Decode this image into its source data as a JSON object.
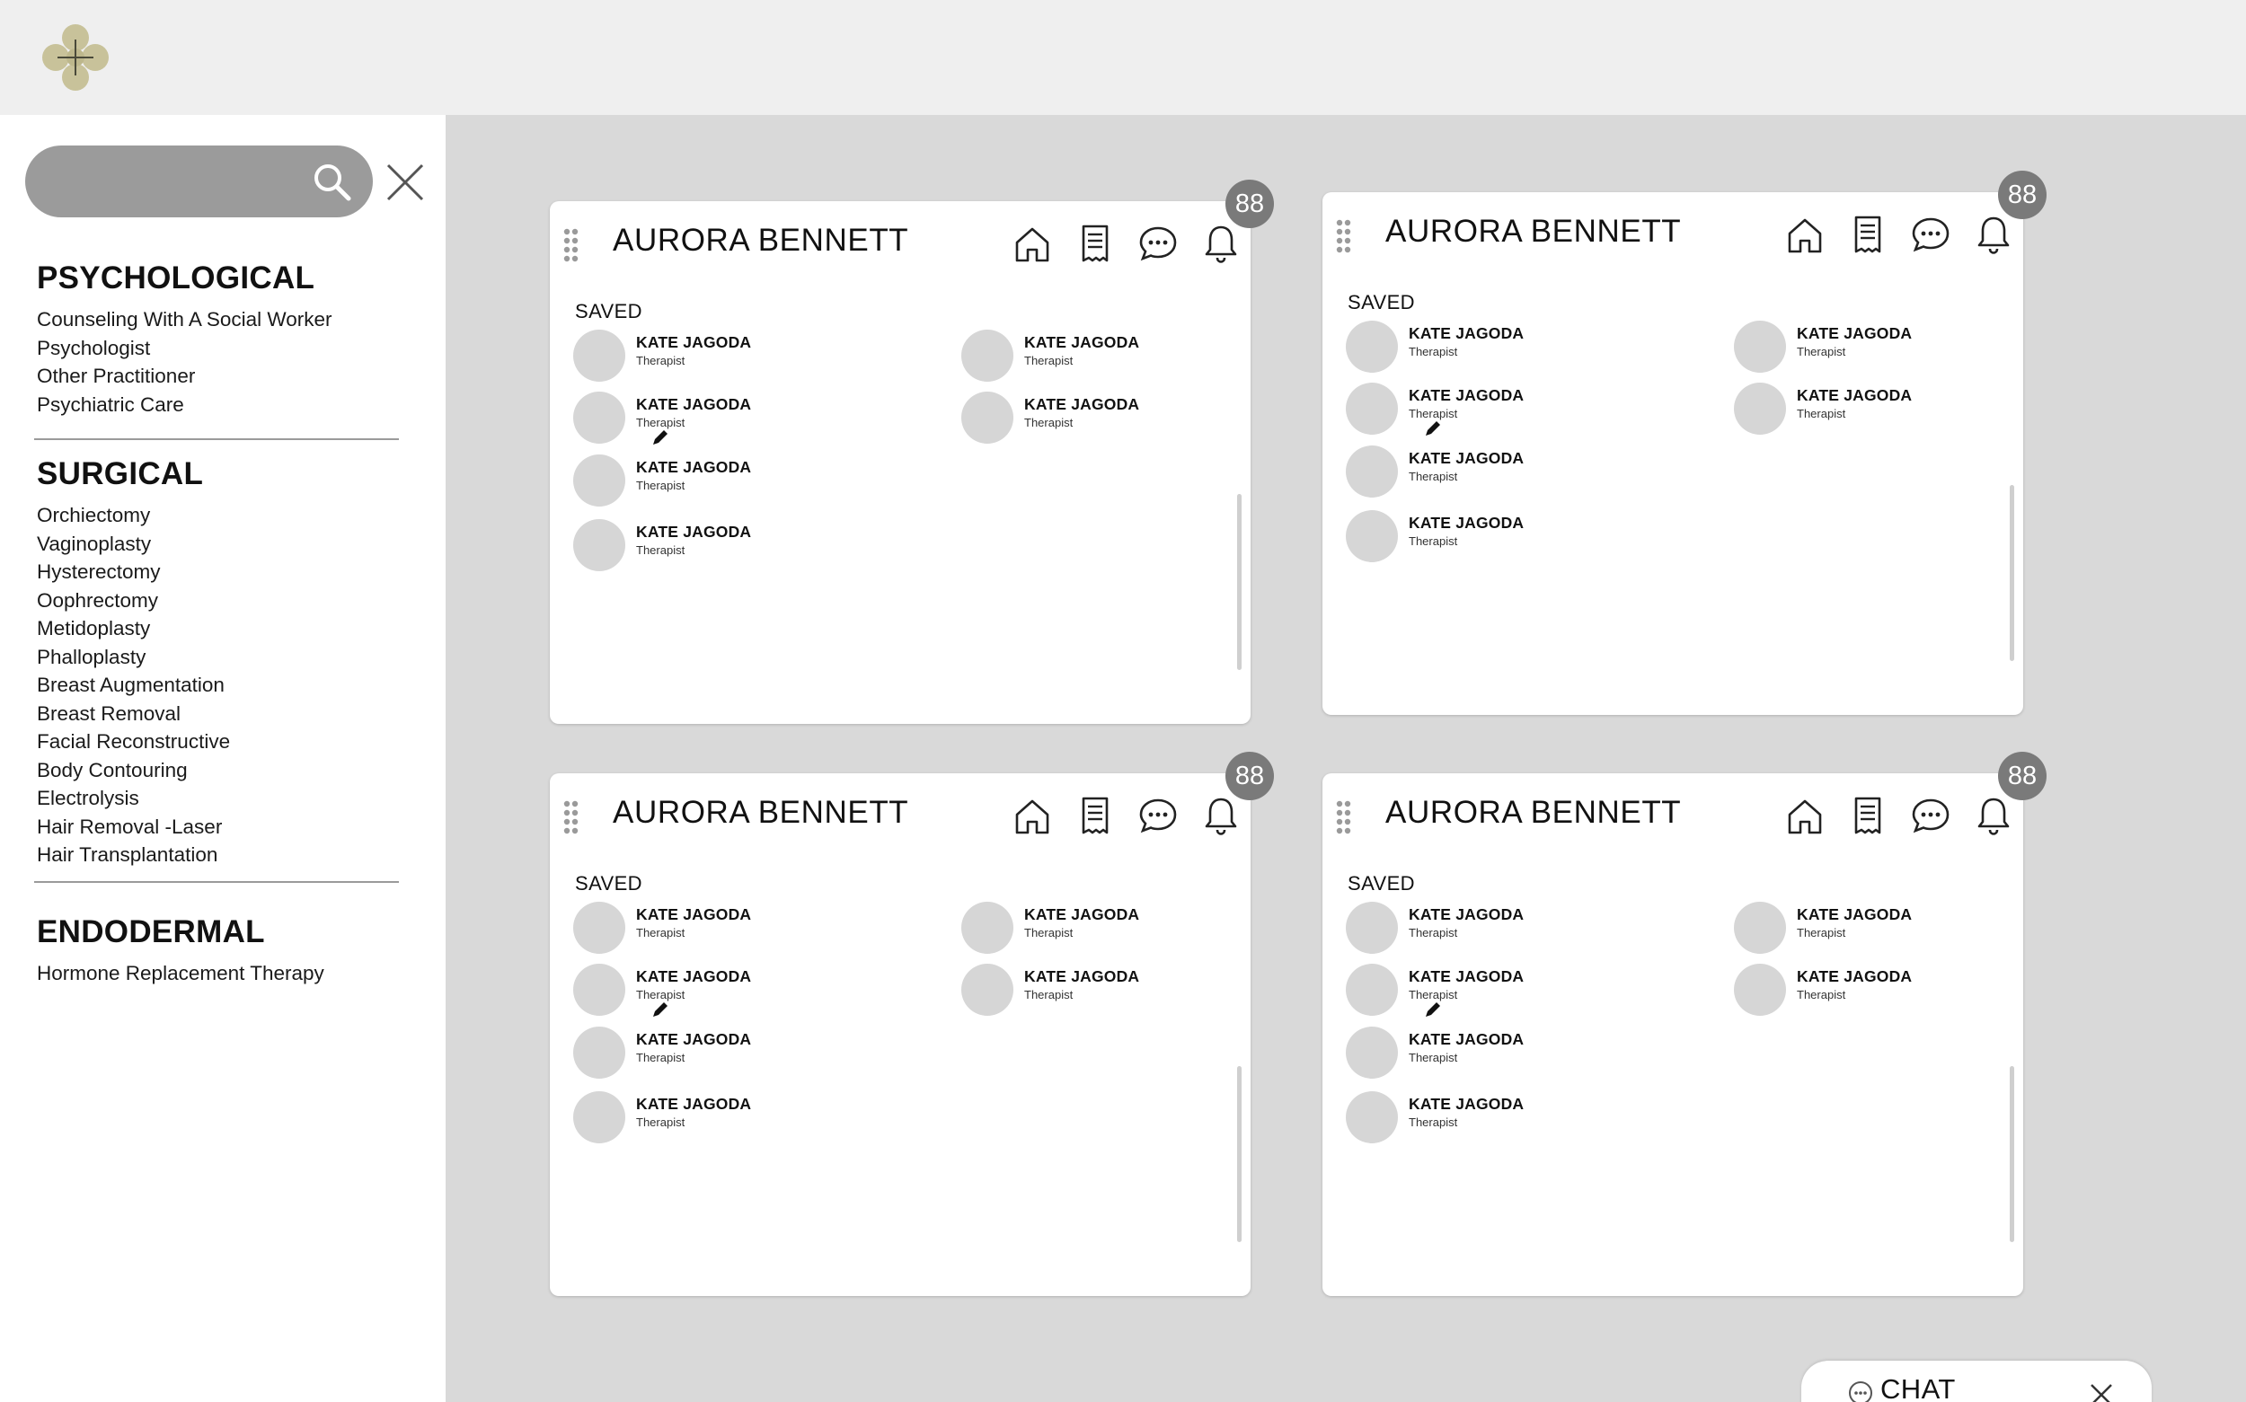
{
  "search": {
    "placeholder": ""
  },
  "categories": [
    {
      "title": "PSYCHOLOGICAL",
      "items": [
        "Counseling With A Social Worker",
        "Psychologist",
        "Other Practitioner",
        "Psychiatric Care"
      ]
    },
    {
      "title": "SURGICAL",
      "items": [
        "Orchiectomy",
        "Vaginoplasty",
        "Hysterectomy",
        "Oophrectomy",
        "Metidoplasty",
        "Phalloplasty",
        "Breast Augmentation",
        "Breast Removal",
        "Facial Reconstructive",
        "Body Contouring",
        "Electrolysis",
        "Hair Removal -Laser",
        "Hair Transplantation"
      ]
    },
    {
      "title": "ENDODERMAL",
      "items": [
        "Hormone Replacement Therapy"
      ]
    }
  ],
  "cards": [
    {
      "name": "AURORA BENNETT",
      "badge": "88",
      "section_label": "SAVED",
      "people": [
        {
          "name": "KATE JAGODA",
          "role": "Therapist"
        },
        {
          "name": "KATE JAGODA",
          "role": "Therapist"
        },
        {
          "name": "KATE JAGODA",
          "role": "Therapist"
        },
        {
          "name": "KATE JAGODA",
          "role": "Therapist"
        },
        {
          "name": "KATE JAGODA",
          "role": "Therapist"
        },
        {
          "name": "KATE JAGODA",
          "role": "Therapist"
        }
      ]
    },
    {
      "name": "AURORA BENNETT",
      "badge": "88",
      "section_label": "SAVED",
      "people": [
        {
          "name": "KATE JAGODA",
          "role": "Therapist"
        },
        {
          "name": "KATE JAGODA",
          "role": "Therapist"
        },
        {
          "name": "KATE JAGODA",
          "role": "Therapist"
        },
        {
          "name": "KATE JAGODA",
          "role": "Therapist"
        },
        {
          "name": "KATE JAGODA",
          "role": "Therapist"
        },
        {
          "name": "KATE JAGODA",
          "role": "Therapist"
        }
      ]
    },
    {
      "name": "AURORA BENNETT",
      "badge": "88",
      "section_label": "SAVED",
      "people": [
        {
          "name": "KATE JAGODA",
          "role": "Therapist"
        },
        {
          "name": "KATE JAGODA",
          "role": "Therapist"
        },
        {
          "name": "KATE JAGODA",
          "role": "Therapist"
        },
        {
          "name": "KATE JAGODA",
          "role": "Therapist"
        },
        {
          "name": "KATE JAGODA",
          "role": "Therapist"
        },
        {
          "name": "KATE JAGODA",
          "role": "Therapist"
        }
      ]
    },
    {
      "name": "AURORA BENNETT",
      "badge": "88",
      "section_label": "SAVED",
      "people": [
        {
          "name": "KATE JAGODA",
          "role": "Therapist"
        },
        {
          "name": "KATE JAGODA",
          "role": "Therapist"
        },
        {
          "name": "KATE JAGODA",
          "role": "Therapist"
        },
        {
          "name": "KATE JAGODA",
          "role": "Therapist"
        },
        {
          "name": "KATE JAGODA",
          "role": "Therapist"
        },
        {
          "name": "KATE JAGODA",
          "role": "Therapist"
        }
      ]
    }
  ],
  "card_icons": [
    "home-icon",
    "receipt-icon",
    "chat-bubble-icon",
    "bell-icon"
  ],
  "chat": {
    "label": "CHAT"
  },
  "colors": {
    "logo": "#c8c29a",
    "badge": "#7a7a7a",
    "search": "#9b9b9b",
    "avatar": "#d6d6d6",
    "workspace": "#d9d9d9"
  }
}
